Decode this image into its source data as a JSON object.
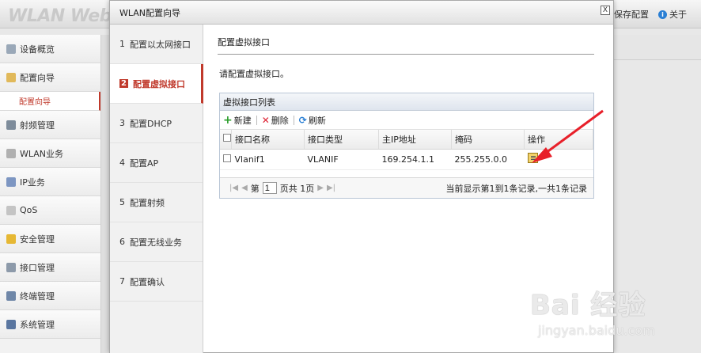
{
  "app": {
    "logo": "WLAN Web管",
    "save_config": "保存配置",
    "about": "关于"
  },
  "sidebar": {
    "items": [
      {
        "label": "设备概览",
        "icon": "device-icon"
      },
      {
        "label": "配置向导",
        "icon": "wizard-icon"
      },
      {
        "label": "射频管理",
        "icon": "radio-icon"
      },
      {
        "label": "WLAN业务",
        "icon": "wlan-icon"
      },
      {
        "label": "IP业务",
        "icon": "ip-icon"
      },
      {
        "label": "QoS",
        "icon": "qos-icon"
      },
      {
        "label": "安全管理",
        "icon": "shield-icon"
      },
      {
        "label": "接口管理",
        "icon": "interface-icon"
      },
      {
        "label": "终端管理",
        "icon": "terminal-icon"
      },
      {
        "label": "系统管理",
        "icon": "system-icon"
      }
    ],
    "sub_item": "配置向导"
  },
  "dialog": {
    "title": "WLAN配置向导",
    "close": "X",
    "steps": [
      {
        "num": "1",
        "label": "配置以太网接口"
      },
      {
        "num": "2",
        "label": "配置虚拟接口"
      },
      {
        "num": "3",
        "label": "配置DHCP"
      },
      {
        "num": "4",
        "label": "配置AP"
      },
      {
        "num": "5",
        "label": "配置射频"
      },
      {
        "num": "6",
        "label": "配置无线业务"
      },
      {
        "num": "7",
        "label": "配置确认"
      }
    ],
    "section_title": "配置虚拟接口",
    "description": "请配置虚拟接口。",
    "grid": {
      "title": "虚拟接口列表",
      "toolbar": {
        "new": "新建",
        "delete": "删除",
        "refresh": "刷新"
      },
      "columns": [
        "接口名称",
        "接口类型",
        "主IP地址",
        "掩码",
        "操作"
      ],
      "rows": [
        {
          "name": "Vlanif1",
          "type": "VLANIF",
          "ip": "169.254.1.1",
          "mask": "255.255.0.0"
        }
      ],
      "pager": {
        "page_prefix": "第",
        "page_value": "1",
        "page_suffix": "页共 1页",
        "status": "当前显示第1到1条记录,一共1条记录"
      }
    }
  },
  "watermark": {
    "main": "Bai 经验",
    "sub": "jingyan.baidu.com"
  },
  "colors": {
    "accent": "#c0392b",
    "annotation_arrow": "#e8202a"
  }
}
